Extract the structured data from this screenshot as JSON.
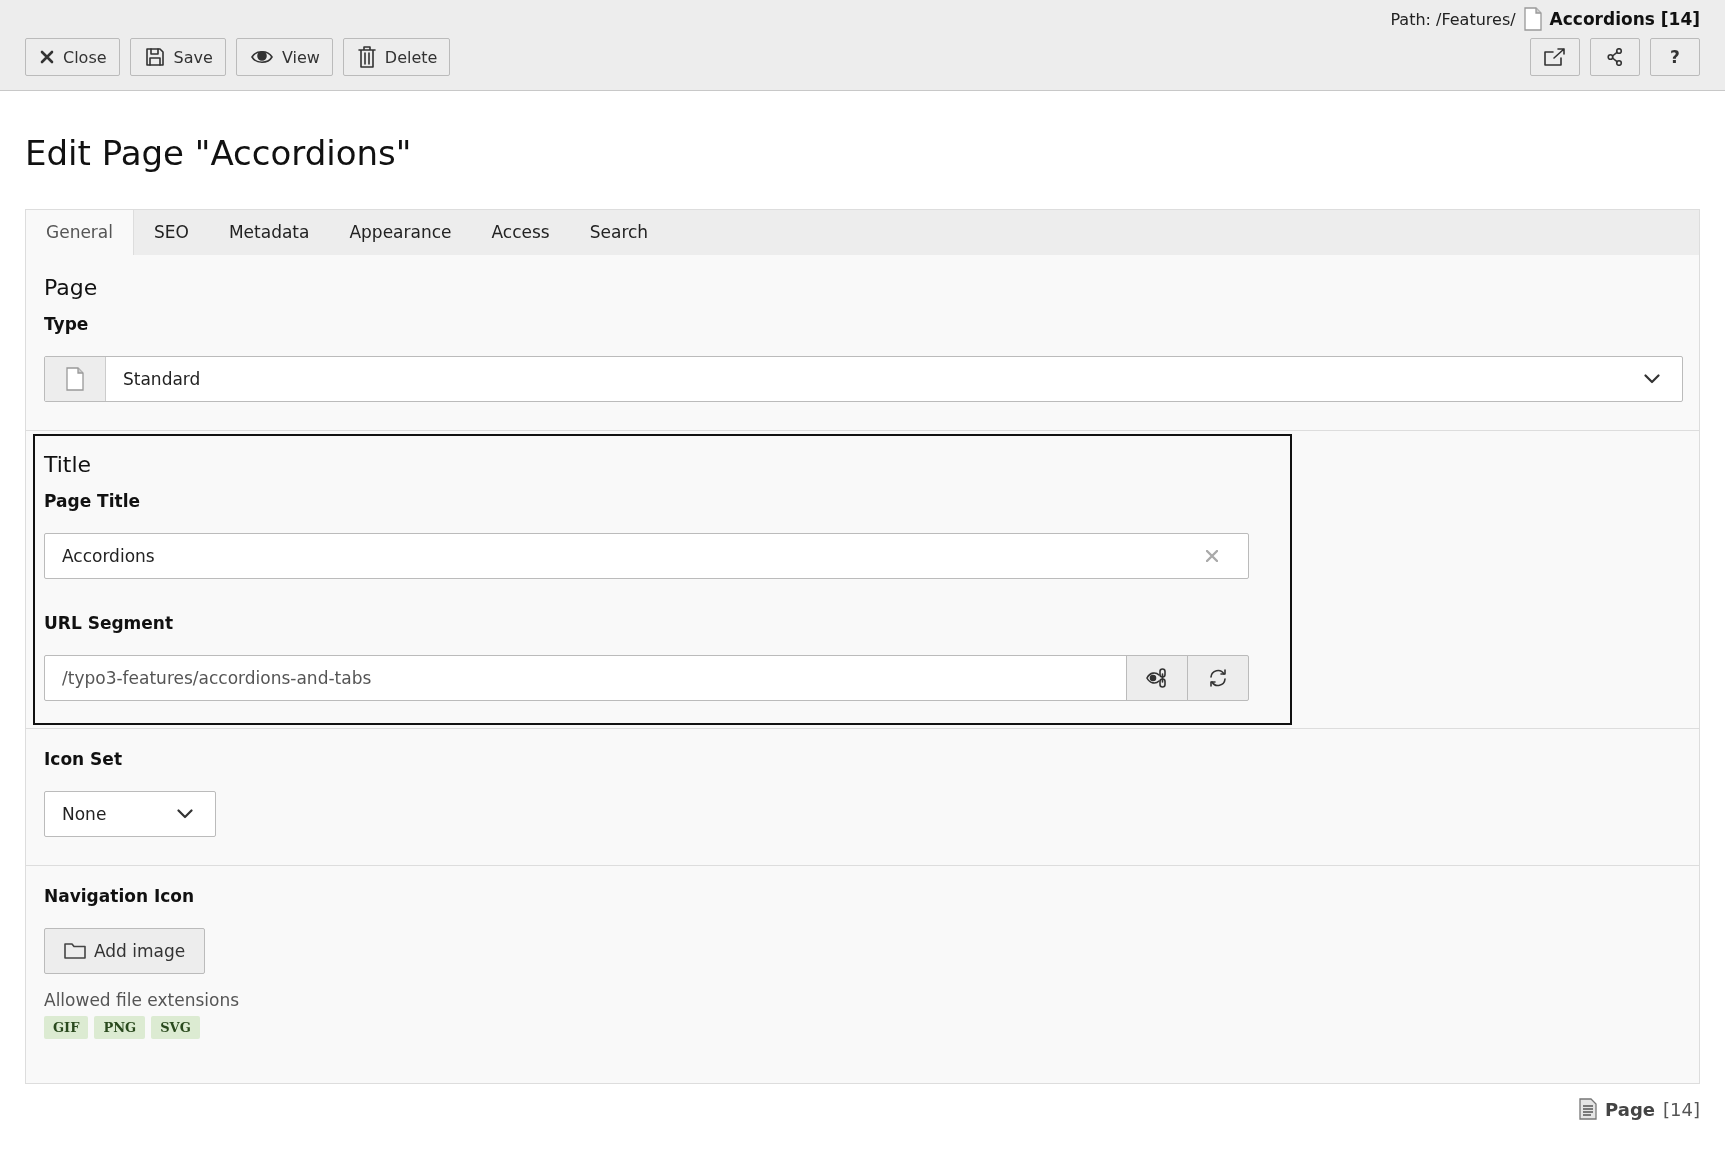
{
  "path": {
    "label": "Path: /Features/",
    "page": "Accordions [14]"
  },
  "toolbar": {
    "buttons": [
      {
        "kind": "close",
        "label": "Close"
      },
      {
        "kind": "save",
        "label": "Save"
      },
      {
        "kind": "view",
        "label": "View"
      },
      {
        "kind": "delete",
        "label": "Delete"
      }
    ],
    "right_buttons": [
      {
        "kind": "open-new"
      },
      {
        "kind": "share"
      },
      {
        "kind": "help",
        "label": "?"
      }
    ]
  },
  "heading": "Edit Page \"Accordions\"",
  "tabs": [
    {
      "label": "General",
      "selected": true
    },
    {
      "label": "SEO",
      "selected": false
    },
    {
      "label": "Metadata",
      "selected": false
    },
    {
      "label": "Appearance",
      "selected": false
    },
    {
      "label": "Access",
      "selected": false
    },
    {
      "label": "Search",
      "selected": false
    }
  ],
  "sections": [
    {
      "title": "Page",
      "focused": false,
      "fields": [
        {
          "kind": "select-icon",
          "label": "Type",
          "value": "Standard"
        }
      ]
    },
    {
      "title": "Title",
      "focused": true,
      "fields": [
        {
          "kind": "text",
          "label": "Page Title",
          "value": "Accordions"
        },
        {
          "kind": "slug",
          "label": "URL Segment",
          "value": "/typo3-features/accordions-and-tabs"
        }
      ]
    },
    {
      "focused": false,
      "fields": [
        {
          "kind": "select",
          "label": "Icon Set",
          "value": "None"
        }
      ]
    },
    {
      "focused": false,
      "fields": [
        {
          "kind": "file",
          "label": "Navigation Icon",
          "button": "Add image",
          "hint": "Allowed file extensions",
          "extensions": [
            "GIF",
            "PNG",
            "SVG"
          ]
        }
      ]
    }
  ],
  "footer": {
    "label": "Page",
    "id": "[14]"
  }
}
